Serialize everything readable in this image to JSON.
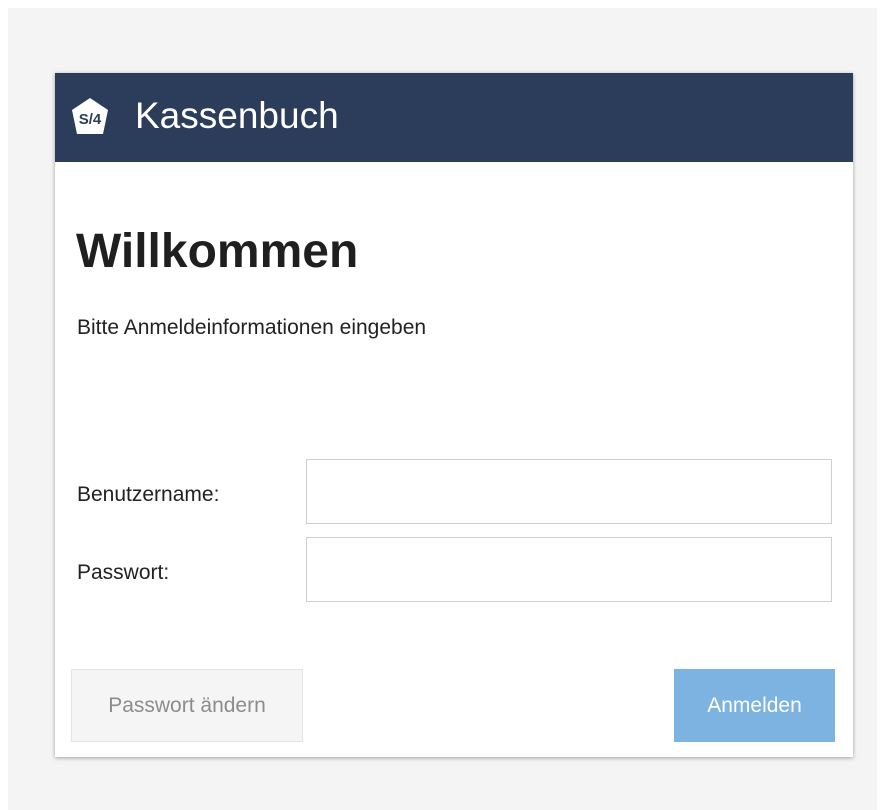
{
  "header": {
    "logo_text": "S/4",
    "app_title": "Kassenbuch"
  },
  "login": {
    "welcome_title": "Willkommen",
    "subtitle": "Bitte Anmeldeinformationen eingeben",
    "username_label": "Benutzername:",
    "username_value": "",
    "password_label": "Passwort:",
    "password_value": "",
    "change_password_label": "Passwort ändern",
    "login_label": "Anmelden"
  },
  "colors": {
    "header_background": "#2b3d5b",
    "login_button": "#7cb3e0",
    "page_background": "#f4f4f4"
  }
}
